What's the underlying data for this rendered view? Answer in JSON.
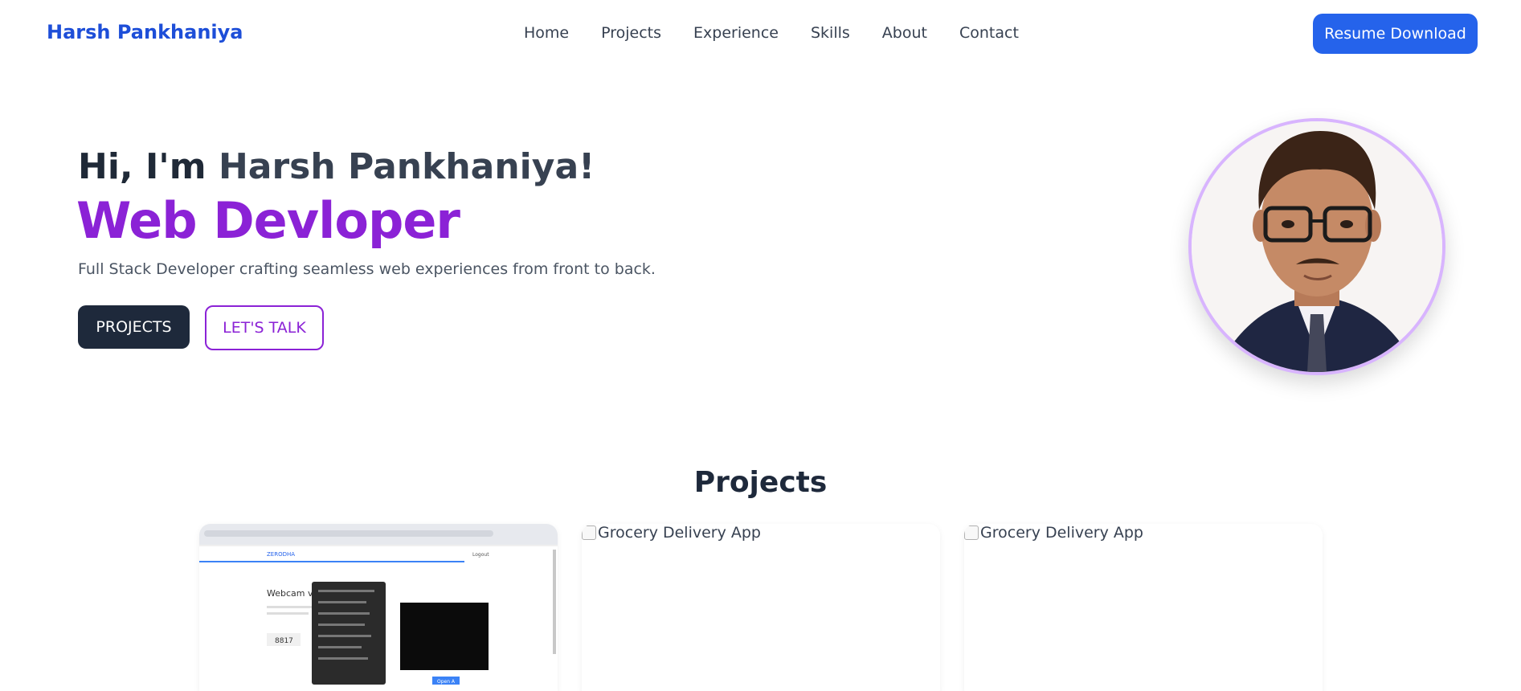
{
  "nav": {
    "brand": "Harsh Pankhaniya",
    "links": [
      "Home",
      "Projects",
      "Experience",
      "Skills",
      "About",
      "Contact"
    ],
    "resume_label": "Resume Download"
  },
  "hero": {
    "greeting_prefix": "Hi, I'm ",
    "greeting_name": "Harsh Pankhaniya!",
    "role": "Web Devloper",
    "tagline": "Full Stack Developer crafting seamless web experiences from front to back.",
    "btn_projects": "PROJECTS",
    "btn_talk": "LET'S TALK"
  },
  "projects": {
    "title": "Projects",
    "cards": [
      {
        "alt": "",
        "screenshot": {
          "logo": "ZERODHA",
          "heading": "Webcam verifi",
          "code": "8817",
          "logout": "Logout",
          "button": "Open A"
        }
      },
      {
        "alt": "Grocery Delivery App"
      },
      {
        "alt": "Grocery Delivery App"
      }
    ]
  },
  "colors": {
    "brand": "#1d4ed8",
    "accent_purple": "#8b22d6",
    "button_blue": "#2563eb",
    "button_dark": "#1e293b"
  }
}
